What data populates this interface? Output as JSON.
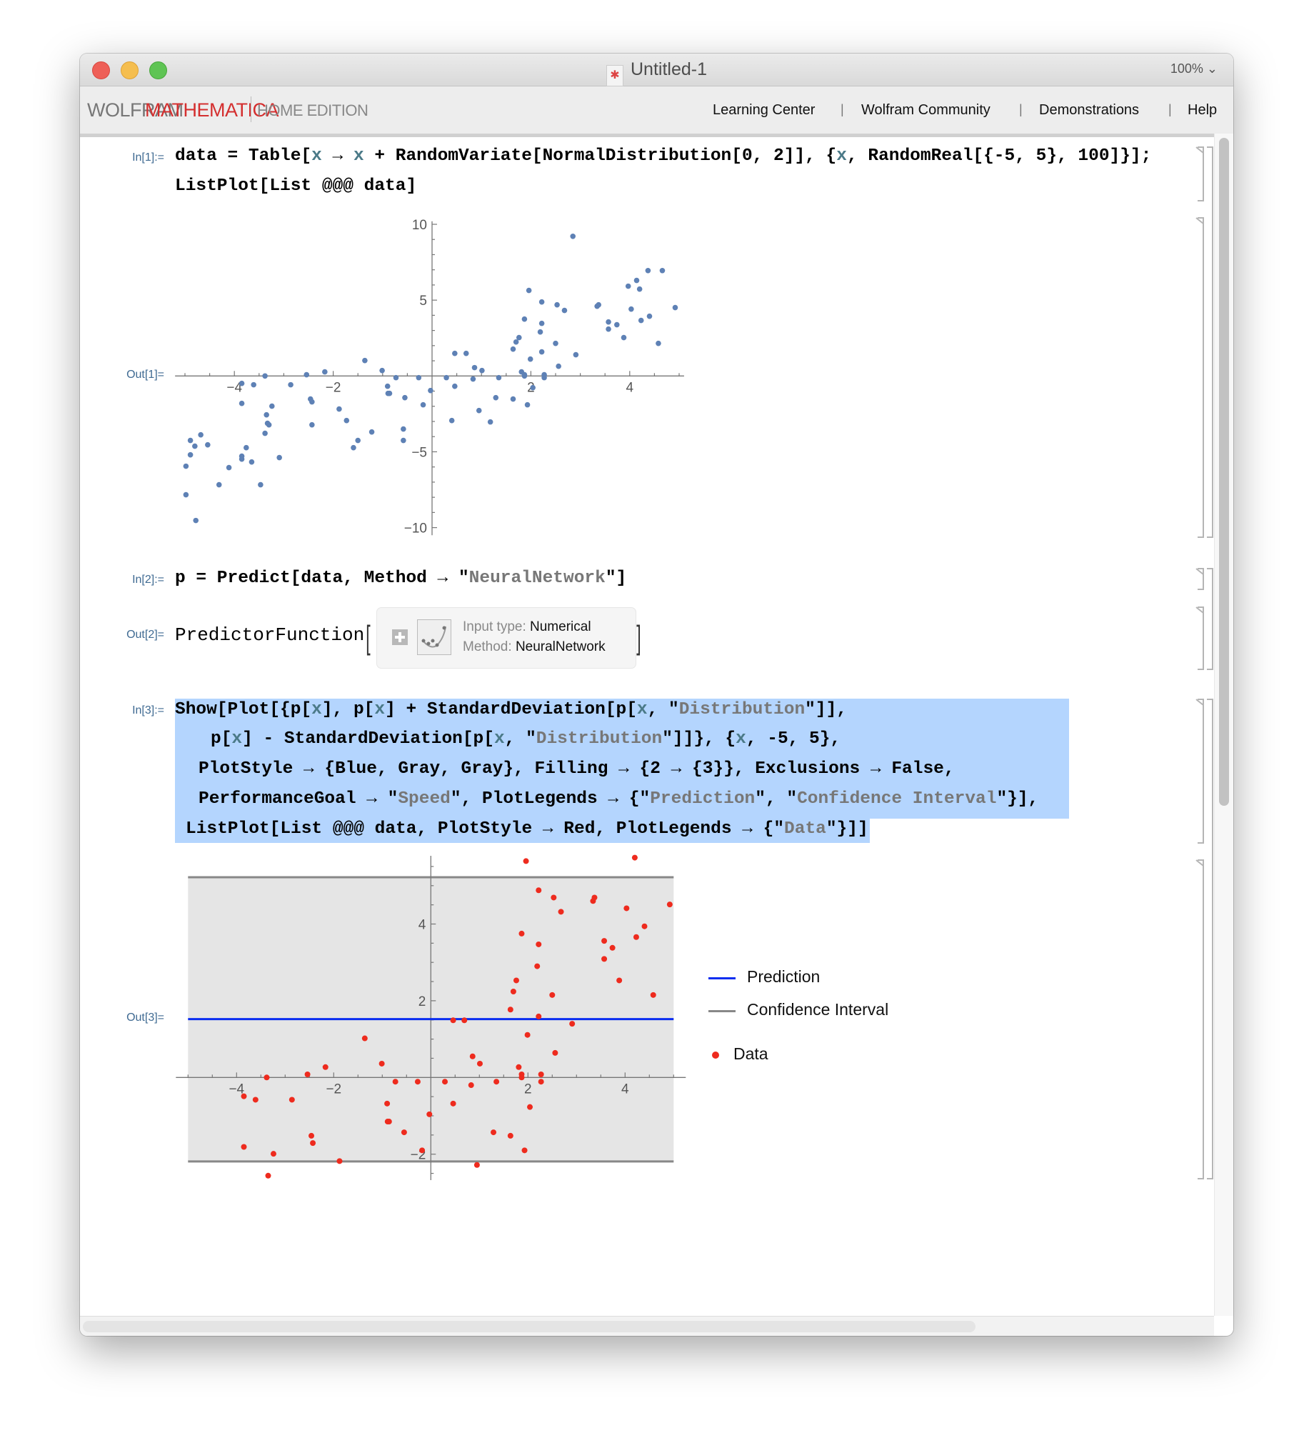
{
  "window": {
    "title": "Untitled-1",
    "zoom": "100% ⌄"
  },
  "toolbar": {
    "brand_wolfram": "WOLFRAM",
    "brand_mathematica": "MATHEMATICA",
    "edition": "HOME EDITION",
    "links": [
      "Learning Center",
      "Wolfram Community",
      "Demonstrations",
      "Help"
    ],
    "separator": "|"
  },
  "colors": {
    "close": "#ee5f57",
    "minimize": "#f5be4f",
    "maximize": "#5fc454",
    "brand_red": "#d42f2f",
    "selection": "#b4d5fe",
    "label": "#3f6a92"
  },
  "cells": [
    {
      "in_label": "In[1]:=",
      "out_label": "Out[1]=",
      "code": [
        [
          [
            "data = Table[",
            "k"
          ],
          [
            "x",
            "v"
          ],
          [
            " → ",
            "k"
          ],
          [
            "x",
            "v"
          ],
          [
            " + RandomVariate[NormalDistribution[0, 2]], {",
            "k"
          ],
          [
            "x",
            "v"
          ],
          [
            ", RandomReal[{-5, 5}, 100]}];",
            "k"
          ]
        ],
        [
          [
            "ListPlot[List @@@ data]",
            "k"
          ]
        ]
      ]
    },
    {
      "in_label": "In[2]:=",
      "out_label": "Out[2]=",
      "code": [
        [
          [
            "p = Predict[data, Method → \"",
            "k"
          ],
          [
            "NeuralNetwork",
            "s"
          ],
          [
            "\"]",
            "k"
          ]
        ]
      ]
    },
    {
      "in_label": "In[3]:=",
      "out_label": "Out[3]=",
      "code": [
        [
          [
            "Show[Plot[{p[",
            "k"
          ],
          [
            "x",
            "v"
          ],
          [
            "], p[",
            "k"
          ],
          [
            "x",
            "v"
          ],
          [
            "] + StandardDeviation[p[",
            "k"
          ],
          [
            "x",
            "v"
          ],
          [
            ", \"",
            "k"
          ],
          [
            "Distribution",
            "s"
          ],
          [
            "\"]],",
            "k"
          ]
        ],
        [
          [
            "p[",
            "k"
          ],
          [
            "x",
            "v"
          ],
          [
            "] - StandardDeviation[p[",
            "k"
          ],
          [
            "x",
            "v"
          ],
          [
            ", \"",
            "k"
          ],
          [
            "Distribution",
            "s"
          ],
          [
            "\"]]}, {",
            "k"
          ],
          [
            "x",
            "v"
          ],
          [
            ", -5, 5},",
            "k"
          ]
        ],
        [
          [
            "PlotStyle → {Blue, Gray, Gray}, Filling → {2 → {3}}, Exclusions → False,",
            "k"
          ]
        ],
        [
          [
            "PerformanceGoal → \"",
            "k"
          ],
          [
            "Speed",
            "s"
          ],
          [
            "\", PlotLegends → {\"",
            "k"
          ],
          [
            "Prediction",
            "s"
          ],
          [
            "\", \"",
            "k"
          ],
          [
            "Confidence Interval",
            "s"
          ],
          [
            "\"}],",
            "k"
          ]
        ],
        [
          [
            "ListPlot[List @@@ data, PlotStyle → Red, PlotLegends → {\"",
            "k"
          ],
          [
            "Data",
            "s"
          ],
          [
            "\"}]]",
            "k"
          ]
        ]
      ]
    }
  ],
  "predictor": {
    "head": "PredictorFunction",
    "open_bracket": "[",
    "close_bracket": "]",
    "input_type_label": "Input type: ",
    "input_type": "Numerical",
    "method_label": "Method: ",
    "method": "NeuralNetwork",
    "icons": [
      "expand-plus-icon",
      "regression-plot-icon"
    ]
  },
  "chart_data": [
    {
      "type": "scatter",
      "xlim": [
        -5.2,
        5.1
      ],
      "ylim": [
        -10.5,
        10.2
      ],
      "x_ticks": [
        -4,
        -2,
        2,
        4
      ],
      "x_tick_labels": [
        "−4",
        "−2",
        "2",
        "4"
      ],
      "y_ticks": [
        -10,
        -5,
        5,
        10
      ],
      "y_tick_labels": [
        "−10",
        "−5",
        "5",
        "10"
      ],
      "grid": false,
      "color": "#5e81b5",
      "points": [
        [
          -1.36,
          1.02
        ],
        [
          -1.01,
          0.36
        ],
        [
          -2.17,
          0.27
        ],
        [
          -2.54,
          0.08
        ],
        [
          -3.38,
          0
        ],
        [
          -3.85,
          -0.49
        ],
        [
          -3.61,
          -0.58
        ],
        [
          -2.86,
          -0.58
        ],
        [
          -0.73,
          -0.11
        ],
        [
          -0.27,
          -0.11
        ],
        [
          -0.9,
          -0.68
        ],
        [
          -0.89,
          -1.15
        ],
        [
          -0.86,
          -1.15
        ],
        [
          -0.03,
          -0.96
        ],
        [
          -0.55,
          -1.43
        ],
        [
          -2.46,
          -1.52
        ],
        [
          -2.43,
          -1.71
        ],
        [
          -0.18,
          -1.9
        ],
        [
          -3.85,
          -1.81
        ],
        [
          -3.24,
          -1.99
        ],
        [
          -1.88,
          -2.18
        ],
        [
          -3.35,
          -2.56
        ],
        [
          -1.73,
          -2.94
        ],
        [
          -3.33,
          -3.12
        ],
        [
          -3.3,
          -3.22
        ],
        [
          -2.43,
          -3.22
        ],
        [
          -0.58,
          -3.5
        ],
        [
          -1.22,
          -3.69
        ],
        [
          -3.38,
          -3.78
        ],
        [
          -4.68,
          -3.88
        ],
        [
          -4.89,
          -4.25
        ],
        [
          -1.5,
          -4.25
        ],
        [
          -0.58,
          -4.25
        ],
        [
          -4.8,
          -4.63
        ],
        [
          -4.54,
          -4.54
        ],
        [
          -3.76,
          -4.73
        ],
        [
          -1.59,
          -4.73
        ],
        [
          -4.89,
          -5.2
        ],
        [
          -3.85,
          -5.29
        ],
        [
          -3.85,
          -5.48
        ],
        [
          -3.09,
          -5.38
        ],
        [
          -3.65,
          -5.67
        ],
        [
          -4.98,
          -5.95
        ],
        [
          -4.11,
          -6.04
        ],
        [
          -4.31,
          -7.17
        ],
        [
          -3.47,
          -7.17
        ],
        [
          -4.98,
          -7.83
        ],
        [
          -4.78,
          -9.53
        ],
        [
          2.85,
          9.21
        ],
        [
          4.37,
          6.95
        ],
        [
          4.66,
          6.95
        ],
        [
          4.14,
          6.3
        ],
        [
          3.97,
          5.92
        ],
        [
          4.2,
          5.73
        ],
        [
          1.96,
          5.64
        ],
        [
          2.22,
          4.88
        ],
        [
          2.53,
          4.69
        ],
        [
          3.34,
          4.6
        ],
        [
          3.37,
          4.69
        ],
        [
          2.68,
          4.32
        ],
        [
          4.03,
          4.41
        ],
        [
          4.92,
          4.51
        ],
        [
          4.4,
          3.94
        ],
        [
          1.87,
          3.75
        ],
        [
          3.57,
          3.56
        ],
        [
          4.23,
          3.66
        ],
        [
          2.22,
          3.47
        ],
        [
          3.74,
          3.38
        ],
        [
          3.57,
          3.09
        ],
        [
          2.19,
          2.9
        ],
        [
          1.76,
          2.53
        ],
        [
          3.88,
          2.53
        ],
        [
          1.7,
          2.24
        ],
        [
          2.5,
          2.15
        ],
        [
          4.58,
          2.15
        ],
        [
          1.64,
          1.77
        ],
        [
          0.46,
          1.49
        ],
        [
          0.69,
          1.49
        ],
        [
          2.22,
          1.59
        ],
        [
          2.91,
          1.4
        ],
        [
          1.99,
          1.11
        ],
        [
          2.56,
          0.64
        ],
        [
          0.86,
          0.55
        ],
        [
          1.01,
          0.36
        ],
        [
          1.81,
          0.27
        ],
        [
          1.87,
          0.08
        ],
        [
          1.87,
          0
        ],
        [
          2.27,
          0.08
        ],
        [
          2.27,
          -0.11
        ],
        [
          0.29,
          -0.11
        ],
        [
          0.83,
          -0.2
        ],
        [
          1.35,
          -0.11
        ],
        [
          0.46,
          -0.68
        ],
        [
          2.04,
          -0.77
        ],
        [
          1.29,
          -1.43
        ],
        [
          1.64,
          -1.52
        ],
        [
          1.93,
          -1.9
        ],
        [
          0.95,
          -2.28
        ],
        [
          0.4,
          -2.94
        ],
        [
          1.18,
          -3.03
        ]
      ]
    },
    {
      "type": "line+scatter",
      "xlim": [
        -5.25,
        5.25
      ],
      "ylim": [
        -2.7,
        5.8
      ],
      "x_ticks": [
        -4,
        -2,
        2,
        4
      ],
      "x_tick_labels": [
        "−4",
        "−2",
        "2",
        "4"
      ],
      "y_ticks": [
        -2,
        2,
        4
      ],
      "y_tick_labels": [
        "−2",
        "2",
        "4"
      ],
      "grid": false,
      "domain": [
        -5,
        5
      ],
      "prediction": 1.52,
      "upper": 5.22,
      "lower": -2.19,
      "fill_color": "#e5e5e5",
      "prediction_color": "#0a2df0",
      "interval_color": "#888888",
      "data_color": "#ee2b1e",
      "data_points": "same as chart 1 points",
      "legend_placement": "right",
      "legend": [
        {
          "label": "Prediction",
          "kind": "line",
          "color": "#0a2df0"
        },
        {
          "label": "Confidence Interval",
          "kind": "line",
          "color": "#888888"
        },
        {
          "label": "Data",
          "kind": "dot",
          "color": "#ee2b1e"
        }
      ]
    }
  ]
}
